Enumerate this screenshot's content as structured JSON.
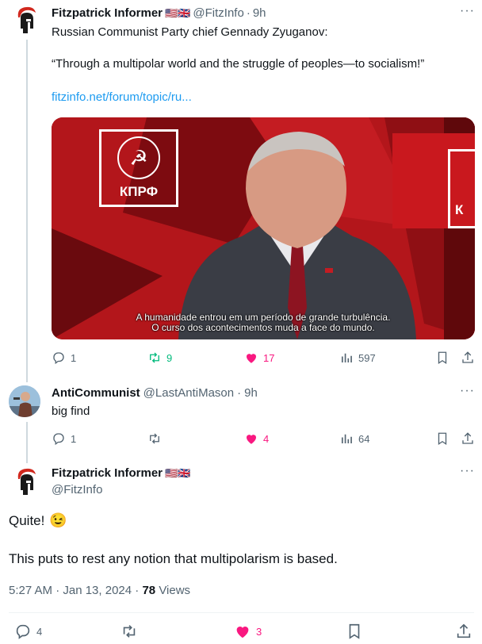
{
  "tweet1": {
    "name": "Fitzpatrick Informer",
    "flags": "🇺🇸🇬🇧",
    "handle": "@FitzInfo",
    "time": "9h",
    "line1": "Russian Communist Party chief Gennady Zyuganov:",
    "quote": "“Through a multipolar world and the struggle of peoples—to socialism!”",
    "link": "fitzinfo.net/forum/topic/ru...",
    "media": {
      "logo_text": "КПРФ",
      "logo_text_right": "К",
      "subtitle_line1": "A humanidade entrou em um período de grande turbulência.",
      "subtitle_line2": "O curso dos acontecimentos muda a face do mundo."
    },
    "replies": "1",
    "reposts": "9",
    "likes": "17",
    "views": "597"
  },
  "tweet2": {
    "name": "AntiCommunist",
    "handle": "@LastAntiMason",
    "time": "9h",
    "text": "big find",
    "replies": "1",
    "likes": "4",
    "views": "64"
  },
  "tweet3": {
    "name": "Fitzpatrick Informer",
    "flags": "🇺🇸🇬🇧",
    "handle": "@FitzInfo",
    "text1": "Quite!",
    "emoji": "😉",
    "text2": "This puts to rest any notion that multipolarism is based.",
    "timestamp": "5:27 AM · Jan 13, 2024",
    "views_count": "78",
    "views_label": "Views",
    "replies": "4",
    "likes": "3"
  },
  "colors": {
    "accent": "#1d9bf0",
    "like": "#f91880",
    "repost": "#00ba7c",
    "muted": "#536471"
  },
  "icons": [
    "reply-icon",
    "repost-icon",
    "like-icon",
    "views-icon",
    "bookmark-icon",
    "share-icon",
    "more-icon"
  ]
}
